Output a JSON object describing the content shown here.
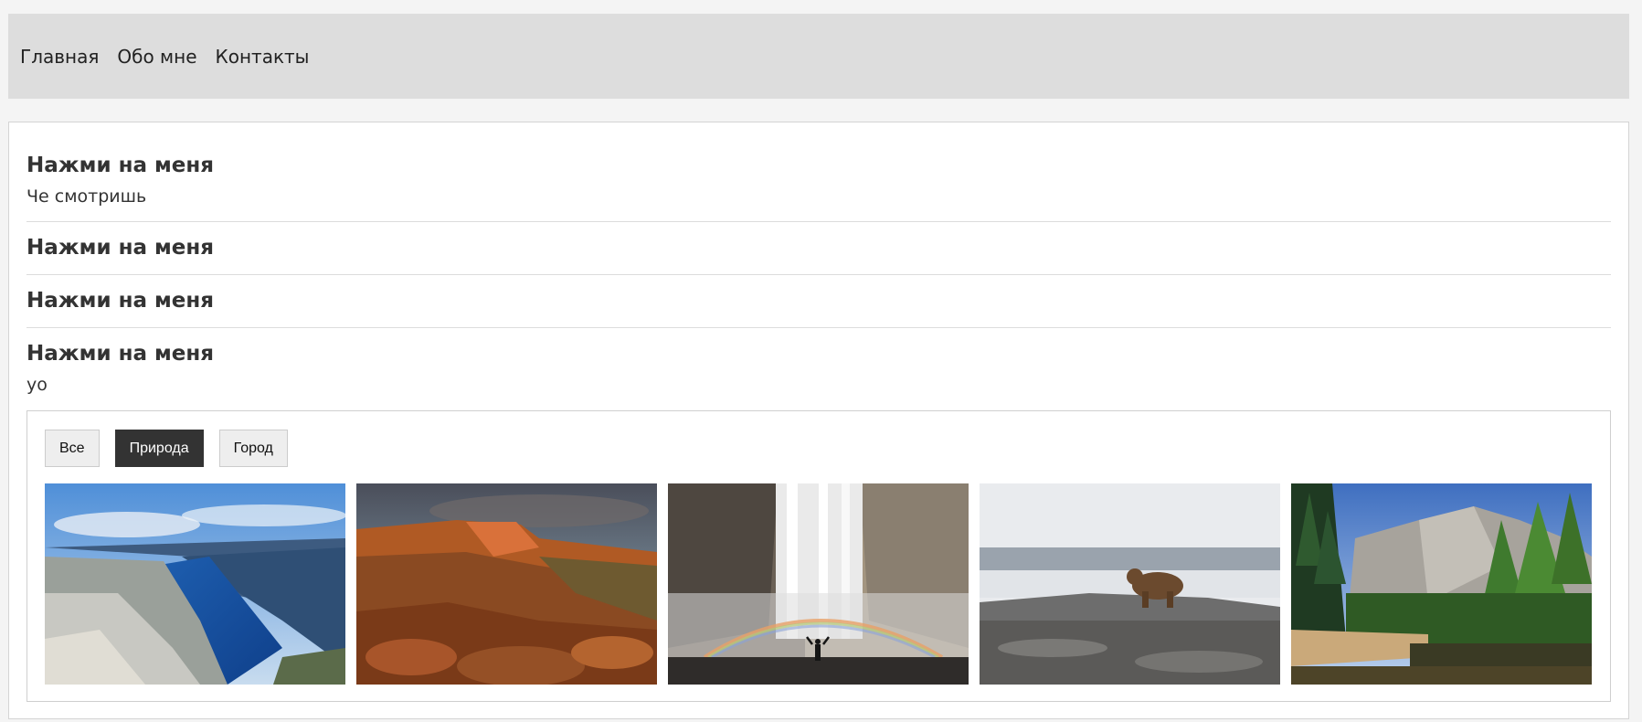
{
  "nav": {
    "items": [
      "Главная",
      "Обо мне",
      "Контакты"
    ]
  },
  "accordion": [
    {
      "title": "Нажми на меня",
      "body": "Че смотришь",
      "open": true
    },
    {
      "title": "Нажми на меня",
      "body": "",
      "open": false
    },
    {
      "title": "Нажми на меня",
      "body": "",
      "open": false
    },
    {
      "title": "Нажми на меня",
      "body": "yo",
      "open": true
    }
  ],
  "gallery": {
    "filters": [
      {
        "label": "Все",
        "active": false
      },
      {
        "label": "Природа",
        "active": true
      },
      {
        "label": "Город",
        "active": false
      }
    ],
    "photos": [
      {
        "subject": "fjord-cliff",
        "category": "nature"
      },
      {
        "subject": "red-canyon",
        "category": "nature"
      },
      {
        "subject": "waterfall-rainbow",
        "category": "nature"
      },
      {
        "subject": "bear-on-rocks",
        "category": "nature"
      },
      {
        "subject": "valley-forest",
        "category": "nature"
      }
    ]
  },
  "colors": {
    "nav_bg": "#dddddd",
    "active_filter": "#333333",
    "page_bg": "#f4f4f4"
  }
}
